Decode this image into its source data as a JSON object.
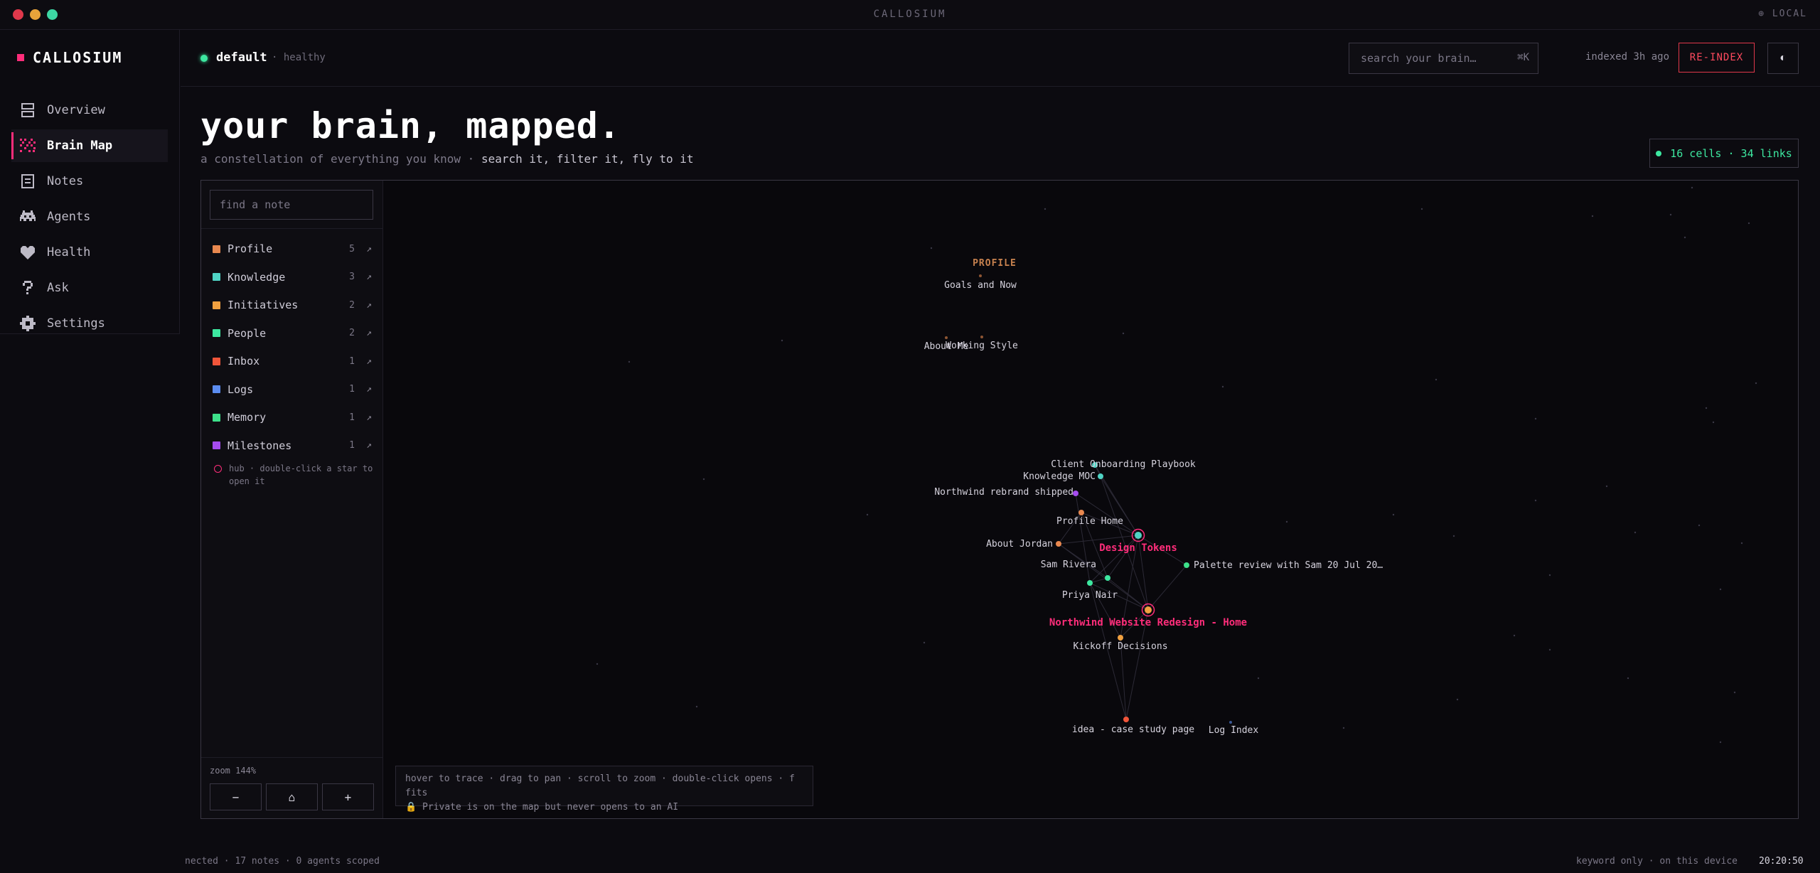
{
  "window": {
    "title": "CALLOSIUM",
    "local": "⊕ LOCAL"
  },
  "brand": {
    "name": "CALLOSIUM"
  },
  "nav": [
    {
      "label": "Overview",
      "icon": "overview-icon"
    },
    {
      "label": "Brain Map",
      "icon": "brain-map-icon",
      "active": true
    },
    {
      "label": "Notes",
      "icon": "notes-icon"
    },
    {
      "label": "Agents",
      "icon": "agents-icon"
    },
    {
      "label": "Health",
      "icon": "heart-icon"
    },
    {
      "label": "Ask",
      "icon": "question-icon"
    },
    {
      "label": "Settings",
      "icon": "gear-icon"
    }
  ],
  "header": {
    "workspace": "default",
    "status": "· healthy",
    "search_placeholder": "search your brain…",
    "search_shortcut": "⌘K",
    "indexed": "indexed 3h ago",
    "reindex": "RE-INDEX",
    "theme_icon": "◐"
  },
  "hero": {
    "title": "your brain, mapped.",
    "subtitle_muted": "a constellation of everything you know ·",
    "subtitle_em": "search it, filter it, fly to it"
  },
  "stats": "16 cells · 34 links",
  "filter": {
    "placeholder": "find a note",
    "categories": [
      {
        "name": "Profile",
        "count": "5",
        "color": "#e8884f"
      },
      {
        "name": "Knowledge",
        "count": "3",
        "color": "#4fd3c4"
      },
      {
        "name": "Initiatives",
        "count": "2",
        "color": "#f0a040"
      },
      {
        "name": "People",
        "count": "2",
        "color": "#3de8a0"
      },
      {
        "name": "Inbox",
        "count": "1",
        "color": "#f0553a"
      },
      {
        "name": "Logs",
        "count": "1",
        "color": "#5b8cf0"
      },
      {
        "name": "Memory",
        "count": "1",
        "color": "#3de08a"
      },
      {
        "name": "Milestones",
        "count": "1",
        "color": "#a64cf0"
      }
    ],
    "go_icon": "↗",
    "hub_note": "hub · double-click a star to open it",
    "zoom": "zoom 144%",
    "zoom_out": "−",
    "zoom_home": "⌂",
    "zoom_in": "+"
  },
  "hint": {
    "line1": "hover to trace · drag to pan · scroll to zoom · double-click opens · f fits",
    "line2": "🔒 Private is on the map but never opens to an AI"
  },
  "graph": {
    "cluster_label": "PROFILE",
    "nodes": [
      {
        "id": "goals",
        "label": "Goals and Now",
        "color": "#e8884f"
      },
      {
        "id": "aboutme",
        "label": "About Me",
        "color": "#e8884f"
      },
      {
        "id": "working",
        "label": "Working Style",
        "color": "#e8884f"
      },
      {
        "id": "client",
        "label": "Client Onboarding Playbook",
        "color": "#4fd3c4"
      },
      {
        "id": "kmoc",
        "label": "Knowledge MOC",
        "color": "#4fd3c4"
      },
      {
        "id": "rebrand",
        "label": "Northwind rebrand shipped",
        "color": "#a64cf0"
      },
      {
        "id": "profilehome",
        "label": "Profile Home",
        "color": "#e8884f"
      },
      {
        "id": "tokens",
        "label": "Design Tokens",
        "color": "#4fd3c4",
        "hub": true
      },
      {
        "id": "jordan",
        "label": "About Jordan",
        "color": "#e8884f"
      },
      {
        "id": "palette",
        "label": "Palette review with Sam 20 Jul 20…",
        "color": "#3de08a"
      },
      {
        "id": "sam",
        "label": "Sam Rivera",
        "color": "#3de8a0"
      },
      {
        "id": "priya",
        "label": "Priya Nair",
        "color": "#3de8a0"
      },
      {
        "id": "northwind",
        "label": "Northwind Website Redesign - Home",
        "color": "#f0a040",
        "hub": true
      },
      {
        "id": "kickoff",
        "label": "Kickoff Decisions",
        "color": "#f0a040"
      },
      {
        "id": "idea",
        "label": "idea - case study page",
        "color": "#f0553a"
      },
      {
        "id": "logindex",
        "label": "Log Index",
        "color": "#5b8cf0"
      }
    ],
    "hub_label_color": "#ff2d7a"
  },
  "footer": {
    "left": "nected · 17 notes · 0 agents scoped",
    "right": "keyword only · on this device",
    "clock": "20:20:50"
  }
}
